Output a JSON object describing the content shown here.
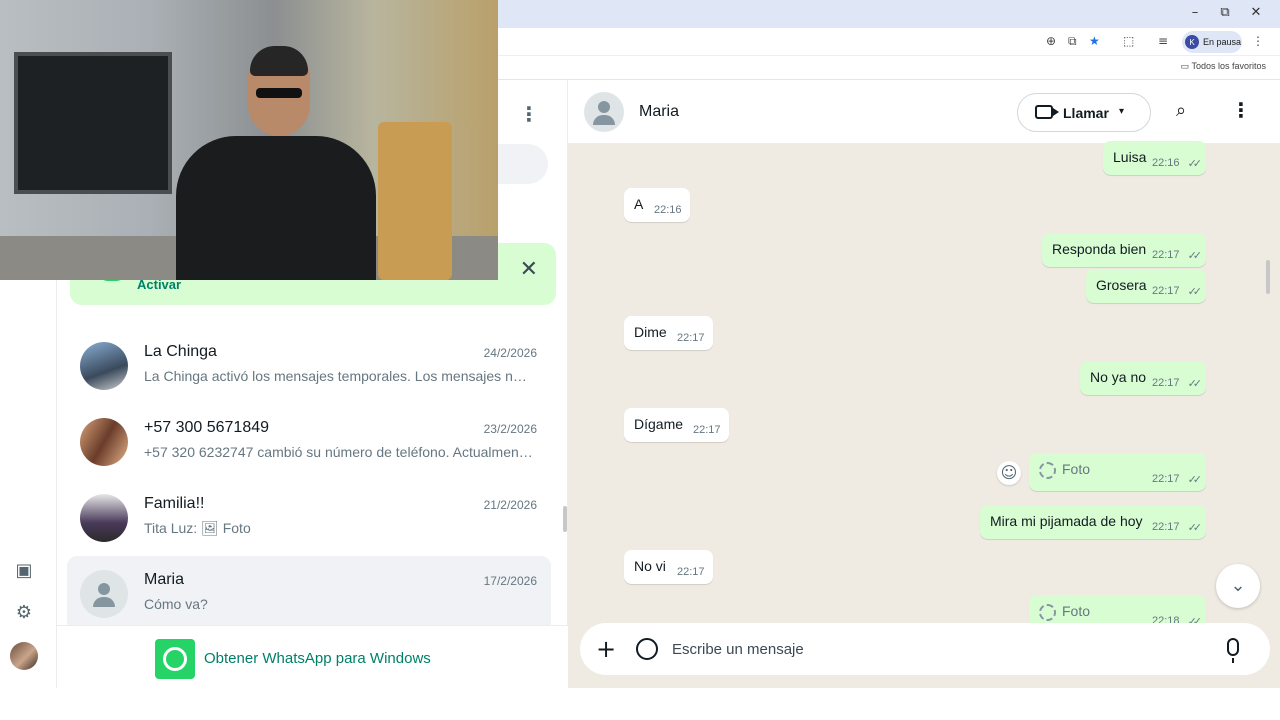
{
  "browser": {
    "minimize": "–",
    "restore": "⧉",
    "close": "✕",
    "profile_initial": "K",
    "profile_status": "En pausa",
    "bookmarks_label": "Todos los favoritos"
  },
  "rail": {
    "media_icon": "media-icon",
    "settings_icon": "gear-icon"
  },
  "chat_list": {
    "menu_icon": "⋮",
    "banner": {
      "action": "Activar",
      "close": "✕"
    },
    "chats": [
      {
        "name": "La Chinga",
        "date": "24/2/2026",
        "preview": "La Chinga activó los mensajes temporales. Los mensajes nuevos desaparecerán"
      },
      {
        "name": "+57 300 5671849",
        "date": "23/2/2026",
        "preview": "+57 320 6232747 cambió su número de teléfono. Actualmente se comunica"
      },
      {
        "name": "Familia!!",
        "date": "21/2/2026",
        "preview": "Tita Luz: 🖼 Foto"
      },
      {
        "name": "Maria",
        "date": "17/2/2026",
        "preview": "Cómo va?"
      }
    ],
    "get_app": "Obtener WhatsApp para Windows"
  },
  "conversation": {
    "contact_name": "Maria",
    "call_label": "Llamar",
    "call_caret": "▾",
    "search_icon": "⌕",
    "menu_icon": "⋮",
    "messages": [
      {
        "dir": "out",
        "text": "Luisa",
        "time": "22:16"
      },
      {
        "dir": "in",
        "text": "A",
        "time": "22:16"
      },
      {
        "dir": "out",
        "text": "Responda bien",
        "time": "22:17"
      },
      {
        "dir": "out",
        "text": "Grosera",
        "time": "22:17"
      },
      {
        "dir": "in",
        "text": "Dime",
        "time": "22:17"
      },
      {
        "dir": "out",
        "text": "No ya no",
        "time": "22:17"
      },
      {
        "dir": "in",
        "text": "Dígame",
        "time": "22:17"
      },
      {
        "dir": "out",
        "text": "Foto",
        "time": "22:17"
      },
      {
        "dir": "out",
        "text": "Mira mi pijamada de hoy",
        "time": "22:17"
      },
      {
        "dir": "in",
        "text": "No vi",
        "time": "22:17"
      },
      {
        "dir": "out",
        "text": "Foto",
        "time": "22:18"
      }
    ],
    "ticks": "✓✓",
    "emoji_icon": "☺",
    "scroll_down_icon": "⌄",
    "composer": {
      "plus": "+",
      "placeholder": "Escribe un mensaje"
    }
  }
}
